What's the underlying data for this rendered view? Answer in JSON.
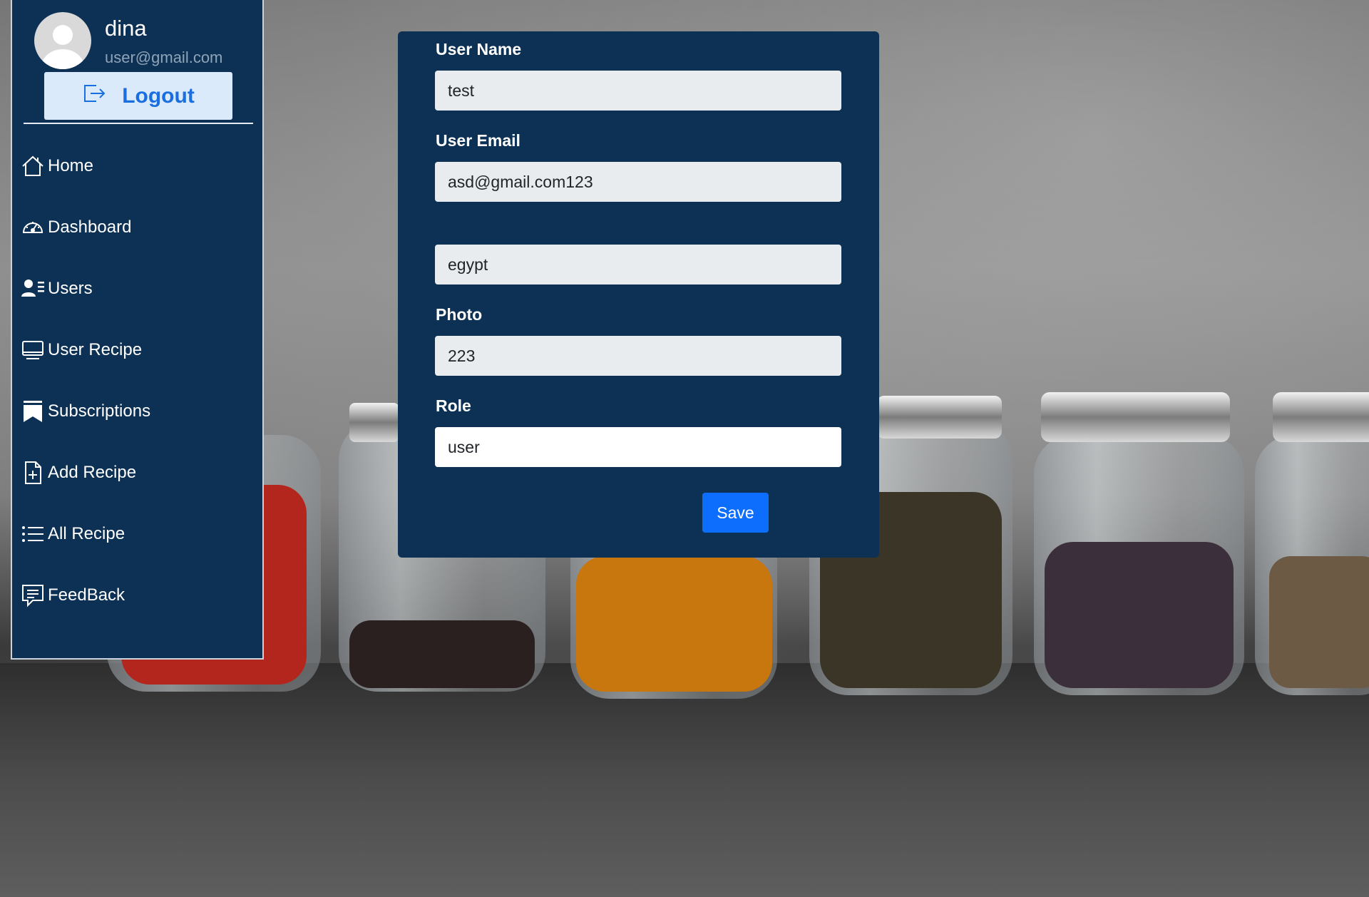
{
  "user": {
    "name": "dina",
    "email": "user@gmail.com"
  },
  "logout": {
    "label": "Logout",
    "icon": "logout-icon"
  },
  "nav": {
    "items": [
      {
        "label": "Home",
        "icon": "home-icon"
      },
      {
        "label": "Dashboard",
        "icon": "speedometer-icon"
      },
      {
        "label": "Users",
        "icon": "users-icon"
      },
      {
        "label": "User Recipe",
        "icon": "display-icon"
      },
      {
        "label": "Subscriptions",
        "icon": "bookmarks-icon"
      },
      {
        "label": "Add Recipe",
        "icon": "file-plus-icon"
      },
      {
        "label": "All Recipe",
        "icon": "list-icon"
      },
      {
        "label": "FeedBack",
        "icon": "chat-square-text-icon"
      }
    ]
  },
  "form": {
    "user_name_label": "User Name",
    "user_name_value": "test",
    "user_email_label": "User Email",
    "user_email_value": "asd@gmail.com123",
    "country_value": "egypt",
    "photo_label": "Photo",
    "photo_value": "223",
    "role_label": "Role",
    "role_value": "user",
    "save_label": "Save"
  },
  "colors": {
    "panel": "#0d3154",
    "accent": "#0d6efd",
    "logout_bg": "#dbeafb",
    "logout_text": "#1a6fe0"
  }
}
